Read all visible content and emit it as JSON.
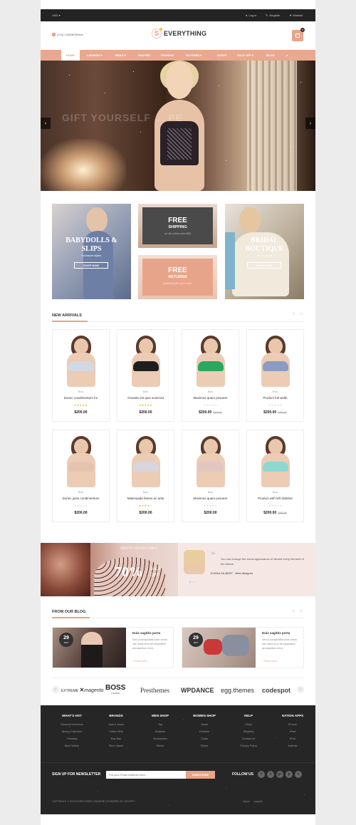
{
  "topbar": {
    "currency": "USD",
    "login": "Log in",
    "register": "Register",
    "wishlist": "Wishlist"
  },
  "header": {
    "phone": "(+01) 123456789xxx",
    "logo_mark": "S",
    "logo_text": "EVERYTHING",
    "cart_count": "0"
  },
  "nav": {
    "items": [
      "HOME",
      "LINGERIE",
      "BRAS",
      "PANTIES",
      "FASHION",
      "CLOTHES",
      "SLEEP",
      "SALE OFF",
      "BLOG"
    ]
  },
  "hero": {
    "caption": "GIFT YOURSELF ... PE"
  },
  "promos": {
    "babydolls": {
      "title": "BABYDOLLS &",
      "title2": "SLIPS",
      "sub": "exclusive styles",
      "button": "SHOP NOW"
    },
    "shipping": {
      "title": "FREE",
      "sub": "SHIPPING",
      "note": "on all orders over $50"
    },
    "returns": {
      "title": "FREE",
      "sub": "RETURNS",
      "note": "anything with your order"
    },
    "bridal": {
      "title": "BRIDAL",
      "title2": "BOUTIQUE",
      "sub": "latest styles",
      "button": "SHOP NOW"
    }
  },
  "new_arrivals": {
    "title": "NEW ARRIVALS",
    "products": [
      {
        "cat": "Bras",
        "name": "Donec condimentum for",
        "stars": "★★★★★",
        "rating": 5,
        "price": "$200.00",
        "old": "",
        "bra": "#d3d8e5"
      },
      {
        "cat": "Bras",
        "name": "Gravida est quis euismod",
        "stars": "★★★★★",
        "rating": 5,
        "price": "$200.00",
        "old": "",
        "bra": "#1e1e1e"
      },
      {
        "cat": "Bras",
        "name": "Maximus quam posuere",
        "stars": "★★★★★",
        "rating": 0,
        "price": "$200.00",
        "old": "$300.00",
        "bra": "#2aa860"
      },
      {
        "cat": "Bras",
        "name": "Product full width",
        "stars": "★★★★★",
        "rating": 0,
        "price": "$200.00",
        "old": "$300.00",
        "bra": "#8c9bc2"
      },
      {
        "cat": "Bras",
        "name": "Donec justo condimentum",
        "stars": "★★★★★",
        "rating": 0,
        "price": "$200.00",
        "old": "",
        "bra": "#e6c3b0"
      },
      {
        "cat": "Bras",
        "name": "Malesuada fames ac ante",
        "stars": "★★★★★",
        "rating": 4,
        "price": "$200.00",
        "old": "",
        "bra": "#d8d6dc"
      },
      {
        "cat": "Bras",
        "name": "Maximus quam posuere",
        "stars": "★★★★★",
        "rating": 0,
        "price": "$200.00",
        "old": "",
        "bra": "#e4c6c0"
      },
      {
        "cat": "Bras",
        "name": "Product with left slidebar",
        "stars": "★★★★★",
        "rating": 0,
        "price": "$200.00",
        "old": "$300.00",
        "bra": "#8fd8cf"
      }
    ]
  },
  "banner": {
    "script": "PRETTY LOVELY GIRLS",
    "percent": "70%",
    "sale": "SALE",
    "off": "OFF"
  },
  "testimonial": {
    "quote": "You can change the visual appearance of almost every element of the theme.",
    "author": "ELENA GILBERT",
    "role": "- Web designer"
  },
  "blog": {
    "title": "FROM OUR BLOG",
    "posts": [
      {
        "day": "29",
        "month": "NOV",
        "title": "Duis sagittis porta",
        "excerpt": "Sed ut perspiciatis unde omnis iste natus error sit voluptatem accusantium error...",
        "more": "+ Read more"
      },
      {
        "day": "29",
        "month": "NOV",
        "title": "Duis sagittis porta",
        "excerpt": "Sed ut perspiciatis unde omnis iste natus error sit voluptatem accusantium error...",
        "more": "+ Read more"
      }
    ]
  },
  "brands": [
    "EXTREME",
    "magento",
    "BOSS",
    "THEMES",
    "Presthemes",
    "WPDANCE",
    "egg.themes",
    "codespot"
  ],
  "footer": {
    "columns": [
      {
        "h": "WHAT'S HOT",
        "links": [
          "Discount Vouchers",
          "Spring Collection",
          "Trending",
          "Best Sellers"
        ]
      },
      {
        "h": "BRANDS",
        "links": [
          "Jack & Jones",
          "Calvin Klein",
          "Ray Ban",
          "River Island"
        ]
      },
      {
        "h": "MEN SHOP",
        "links": [
          "Top",
          "Bottoms",
          "Accessories",
          "Shoes"
        ]
      },
      {
        "h": "WOMEN SHOP",
        "links": [
          "Jeans",
          "Dresses",
          "Coats",
          "Shoes"
        ]
      },
      {
        "h": "HELP",
        "links": [
          "FAQs",
          "Shipping",
          "Contact Us",
          "Privacy Policy"
        ]
      },
      {
        "h": "NATION APPS",
        "links": [
          "iPhone",
          "iPad",
          "iPod",
          "Android"
        ]
      }
    ],
    "newsletter_label": "SIGN UP FOR NEWSLETTER",
    "newsletter_placeholder": "Put your Email Address here...",
    "subscribe": "SUBSCRIBE",
    "follow": "FOLLOW US",
    "social": [
      "f",
      "t",
      "g+",
      "p",
      "<"
    ],
    "copyright": "COPYRIGHT © 2015 EVERYTHING LINGERIE | POWERED BY SHOPIFY",
    "payments": [
      "stripe",
      "paypal"
    ]
  }
}
